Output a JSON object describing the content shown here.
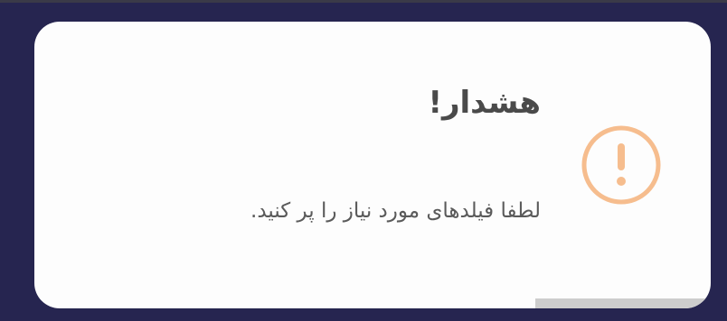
{
  "alert": {
    "title": "هشدار!",
    "message": "لطفا فیلدهای مورد نیاز را پر کنید.",
    "icon": "exclamation-circle-icon",
    "icon_color": "#f6bd8e",
    "progress_remaining": 0.26,
    "progress_color": "#cdcdcd",
    "background_color": "#fdfdfd"
  }
}
